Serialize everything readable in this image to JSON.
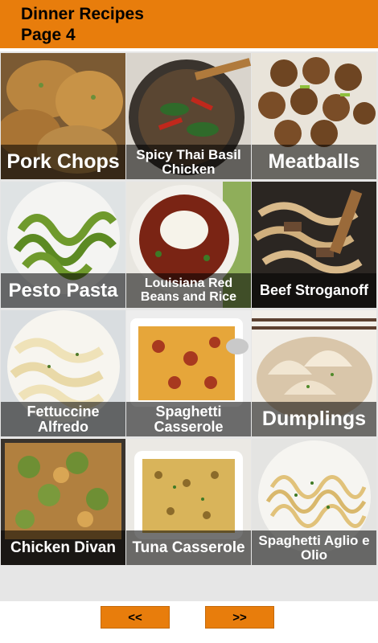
{
  "header": {
    "title_line1": "Dinner Recipes",
    "title_line2": "Page 4",
    "bg_color": "#e87d0c"
  },
  "recipes": [
    {
      "name": "Pork Chops"
    },
    {
      "name": "Spicy Thai Basil Chicken"
    },
    {
      "name": "Meatballs"
    },
    {
      "name": "Pesto Pasta"
    },
    {
      "name": "Louisiana Red Beans and Rice"
    },
    {
      "name": "Beef Stroganoff"
    },
    {
      "name": "Fettuccine Alfredo"
    },
    {
      "name": "Spaghetti Casserole"
    },
    {
      "name": "Dumplings"
    },
    {
      "name": "Chicken Divan"
    },
    {
      "name": "Tuna Casserole"
    },
    {
      "name": "Spaghetti Aglio e Olio"
    }
  ],
  "nav": {
    "prev_label": "<<",
    "next_label": ">>"
  }
}
